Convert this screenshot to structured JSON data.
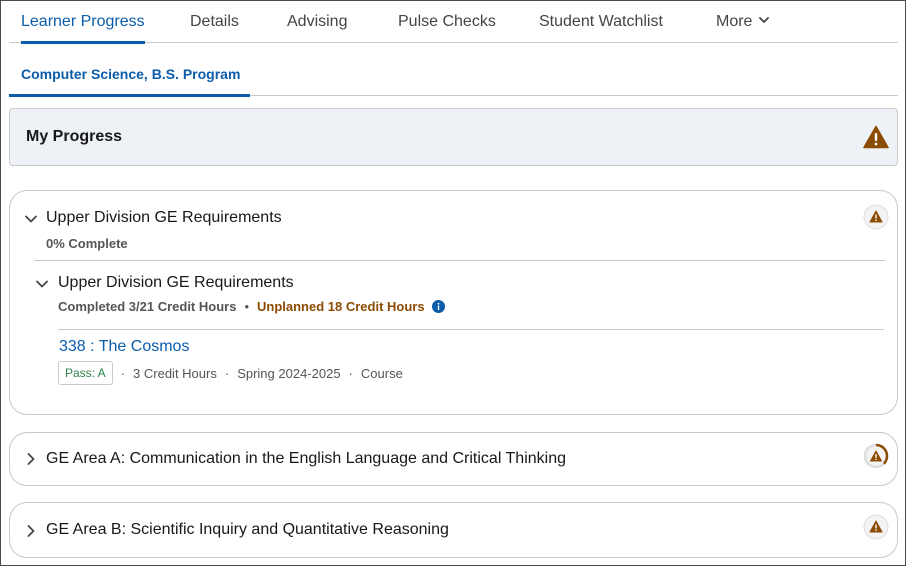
{
  "tabs": [
    {
      "label": "Learner Progress",
      "active": true
    },
    {
      "label": "Details",
      "active": false
    },
    {
      "label": "Advising",
      "active": false
    },
    {
      "label": "Pulse Checks",
      "active": false
    },
    {
      "label": "Student Watchlist",
      "active": false
    },
    {
      "label": "More",
      "active": false
    }
  ],
  "subtab": {
    "label": "Computer Science, B.S. Program"
  },
  "progress_header": {
    "title": "My Progress",
    "icon": "warning-icon"
  },
  "sections": [
    {
      "title": "Upper Division GE Requirements",
      "expanded": true,
      "completion": "0% Complete",
      "status_icon": "warning-icon",
      "child": {
        "title": "Upper Division GE Requirements",
        "completed": "Completed 3/21 Credit Hours",
        "unplanned": "Unplanned 18 Credit Hours",
        "course": {
          "name": "338 : The Cosmos",
          "grade": "Pass: A",
          "credits": "3 Credit Hours",
          "term": "Spring 2024-2025",
          "type": "Course"
        }
      }
    },
    {
      "title": "GE Area A: Communication in the English Language and Critical Thinking",
      "expanded": false,
      "status_icon": "warning-progress-ring-icon"
    },
    {
      "title": "GE Area B: Scientific Inquiry and Quantitative Reasoning",
      "expanded": false,
      "status_icon": "warning-icon"
    }
  ],
  "colors": {
    "brand": "#0b5cab",
    "warning": "#8c4b02",
    "success": "#2e844a",
    "header_bg": "#eef1f6",
    "border": "#c9c9c9"
  }
}
